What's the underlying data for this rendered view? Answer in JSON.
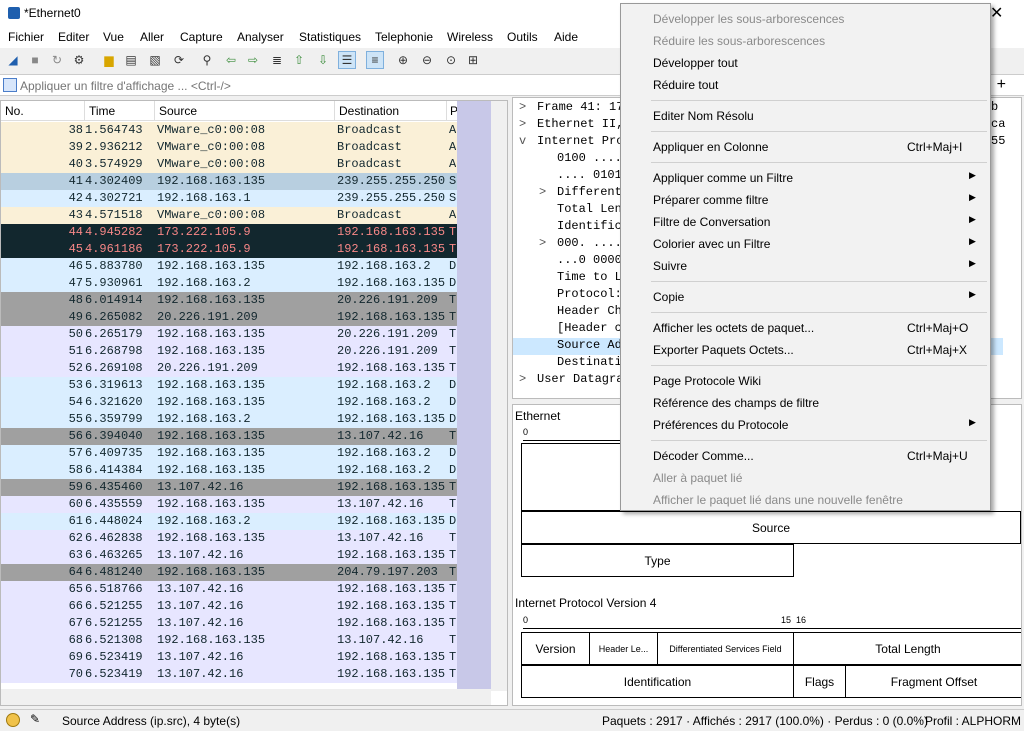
{
  "window": {
    "title": "*Ethernet0",
    "close": "✕"
  },
  "menu": [
    "Fichier",
    "Editer",
    "Vue",
    "Aller",
    "Capture",
    "Analyser",
    "Statistiques",
    "Telephonie",
    "Wireless",
    "Outils",
    "Aide"
  ],
  "filter": {
    "placeholder": "Appliquer un filtre d'affichage ... <Ctrl-/>",
    "add": "+"
  },
  "packet_list": {
    "columns": [
      "No.",
      "Time",
      "Source",
      "Destination",
      "P"
    ],
    "rows": [
      {
        "no": "38",
        "time": "1.564743",
        "src": "VMware_c0:00:08",
        "dst": "Broadcast",
        "proto": "A",
        "bg": "#faf0d7",
        "fg": "#12272e"
      },
      {
        "no": "39",
        "time": "2.936212",
        "src": "VMware_c0:00:08",
        "dst": "Broadcast",
        "proto": "A",
        "bg": "#faf0d7",
        "fg": "#12272e"
      },
      {
        "no": "40",
        "time": "3.574929",
        "src": "VMware_c0:00:08",
        "dst": "Broadcast",
        "proto": "A",
        "bg": "#faf0d7",
        "fg": "#12272e"
      },
      {
        "no": "41",
        "time": "4.302409",
        "src": "192.168.163.135",
        "dst": "239.255.255.250",
        "proto": "S",
        "bg": "#b8cfe0",
        "fg": "#12272e"
      },
      {
        "no": "42",
        "time": "4.302721",
        "src": "192.168.163.1",
        "dst": "239.255.255.250",
        "proto": "S",
        "bg": "#daeeff",
        "fg": "#12272e"
      },
      {
        "no": "43",
        "time": "4.571518",
        "src": "VMware_c0:00:08",
        "dst": "Broadcast",
        "proto": "A",
        "bg": "#faf0d7",
        "fg": "#12272e"
      },
      {
        "no": "44",
        "time": "4.945282",
        "src": "173.222.105.9",
        "dst": "192.168.163.135",
        "proto": "T",
        "bg": "#12272e",
        "fg": "#f78787"
      },
      {
        "no": "45",
        "time": "4.961186",
        "src": "173.222.105.9",
        "dst": "192.168.163.135",
        "proto": "T",
        "bg": "#12272e",
        "fg": "#f78787"
      },
      {
        "no": "46",
        "time": "5.883780",
        "src": "192.168.163.135",
        "dst": "192.168.163.2",
        "proto": "D",
        "bg": "#daeeff",
        "fg": "#12272e"
      },
      {
        "no": "47",
        "time": "5.930961",
        "src": "192.168.163.2",
        "dst": "192.168.163.135",
        "proto": "D",
        "bg": "#daeeff",
        "fg": "#12272e"
      },
      {
        "no": "48",
        "time": "6.014914",
        "src": "192.168.163.135",
        "dst": "20.226.191.209",
        "proto": "T",
        "bg": "#a0a0a0",
        "fg": "#12272e"
      },
      {
        "no": "49",
        "time": "6.265082",
        "src": "20.226.191.209",
        "dst": "192.168.163.135",
        "proto": "T",
        "bg": "#a0a0a0",
        "fg": "#12272e"
      },
      {
        "no": "50",
        "time": "6.265179",
        "src": "192.168.163.135",
        "dst": "20.226.191.209",
        "proto": "T",
        "bg": "#e7e6ff",
        "fg": "#12272e"
      },
      {
        "no": "51",
        "time": "6.268798",
        "src": "192.168.163.135",
        "dst": "20.226.191.209",
        "proto": "T",
        "bg": "#e7e6ff",
        "fg": "#12272e"
      },
      {
        "no": "52",
        "time": "6.269108",
        "src": "20.226.191.209",
        "dst": "192.168.163.135",
        "proto": "T",
        "bg": "#e7e6ff",
        "fg": "#12272e"
      },
      {
        "no": "53",
        "time": "6.319613",
        "src": "192.168.163.135",
        "dst": "192.168.163.2",
        "proto": "D",
        "bg": "#daeeff",
        "fg": "#12272e"
      },
      {
        "no": "54",
        "time": "6.321620",
        "src": "192.168.163.135",
        "dst": "192.168.163.2",
        "proto": "D",
        "bg": "#daeeff",
        "fg": "#12272e"
      },
      {
        "no": "55",
        "time": "6.359799",
        "src": "192.168.163.2",
        "dst": "192.168.163.135",
        "proto": "D",
        "bg": "#daeeff",
        "fg": "#12272e"
      },
      {
        "no": "56",
        "time": "6.394040",
        "src": "192.168.163.135",
        "dst": "13.107.42.16",
        "proto": "T",
        "bg": "#a0a0a0",
        "fg": "#12272e"
      },
      {
        "no": "57",
        "time": "6.409735",
        "src": "192.168.163.135",
        "dst": "192.168.163.2",
        "proto": "D",
        "bg": "#daeeff",
        "fg": "#12272e"
      },
      {
        "no": "58",
        "time": "6.414384",
        "src": "192.168.163.135",
        "dst": "192.168.163.2",
        "proto": "D",
        "bg": "#daeeff",
        "fg": "#12272e"
      },
      {
        "no": "59",
        "time": "6.435460",
        "src": "13.107.42.16",
        "dst": "192.168.163.135",
        "proto": "T",
        "bg": "#a0a0a0",
        "fg": "#12272e"
      },
      {
        "no": "60",
        "time": "6.435559",
        "src": "192.168.163.135",
        "dst": "13.107.42.16",
        "proto": "T",
        "bg": "#e7e6ff",
        "fg": "#12272e"
      },
      {
        "no": "61",
        "time": "6.448024",
        "src": "192.168.163.2",
        "dst": "192.168.163.135",
        "proto": "D",
        "bg": "#daeeff",
        "fg": "#12272e"
      },
      {
        "no": "62",
        "time": "6.462838",
        "src": "192.168.163.135",
        "dst": "13.107.42.16",
        "proto": "T",
        "bg": "#e7e6ff",
        "fg": "#12272e"
      },
      {
        "no": "63",
        "time": "6.463265",
        "src": "13.107.42.16",
        "dst": "192.168.163.135",
        "proto": "T",
        "bg": "#e7e6ff",
        "fg": "#12272e"
      },
      {
        "no": "64",
        "time": "6.481240",
        "src": "192.168.163.135",
        "dst": "204.79.197.203",
        "proto": "T",
        "bg": "#a0a0a0",
        "fg": "#12272e"
      },
      {
        "no": "65",
        "time": "6.518766",
        "src": "13.107.42.16",
        "dst": "192.168.163.135",
        "proto": "T",
        "bg": "#e7e6ff",
        "fg": "#12272e"
      },
      {
        "no": "66",
        "time": "6.521255",
        "src": "13.107.42.16",
        "dst": "192.168.163.135",
        "proto": "T",
        "bg": "#e7e6ff",
        "fg": "#12272e"
      },
      {
        "no": "67",
        "time": "6.521255",
        "src": "13.107.42.16",
        "dst": "192.168.163.135",
        "proto": "T",
        "bg": "#e7e6ff",
        "fg": "#12272e"
      },
      {
        "no": "68",
        "time": "6.521308",
        "src": "192.168.163.135",
        "dst": "13.107.42.16",
        "proto": "T",
        "bg": "#e7e6ff",
        "fg": "#12272e"
      },
      {
        "no": "69",
        "time": "6.523419",
        "src": "13.107.42.16",
        "dst": "192.168.163.135",
        "proto": "T",
        "bg": "#e7e6ff",
        "fg": "#12272e"
      },
      {
        "no": "70",
        "time": "6.523419",
        "src": "13.107.42.16",
        "dst": "192.168.163.135",
        "proto": "T",
        "bg": "#e7e6ff",
        "fg": "#12272e"
      }
    ]
  },
  "details": {
    "lines": [
      {
        "arrow": ">",
        "text": "Frame 41: 17",
        "indent": 0
      },
      {
        "arrow": ">",
        "text": "Ethernet II,",
        "indent": 0
      },
      {
        "arrow": "v",
        "text": "Internet Pro",
        "indent": 0
      },
      {
        "arrow": "",
        "text": "0100 ....",
        "indent": 1
      },
      {
        "arrow": "",
        "text": ".... 0101",
        "indent": 1
      },
      {
        "arrow": ">",
        "text": "Different",
        "indent": 1
      },
      {
        "arrow": "",
        "text": "Total Len",
        "indent": 1
      },
      {
        "arrow": "",
        "text": "Identific",
        "indent": 1
      },
      {
        "arrow": ">",
        "text": "000. ....",
        "indent": 1
      },
      {
        "arrow": "",
        "text": "...0 0000",
        "indent": 1
      },
      {
        "arrow": "",
        "text": "Time to L",
        "indent": 1
      },
      {
        "arrow": "",
        "text": "Protocol:",
        "indent": 1
      },
      {
        "arrow": "",
        "text": "Header Ch",
        "indent": 1
      },
      {
        "arrow": "",
        "text": "[Header c",
        "indent": 1
      },
      {
        "arrow": "",
        "text": "Source Ad",
        "indent": 1,
        "selected": true
      },
      {
        "arrow": "",
        "text": "Destinati",
        "indent": 1
      },
      {
        "arrow": ">",
        "text": "User Datagra",
        "indent": 0
      }
    ],
    "right_fragments": [
      "b",
      "ca",
      "55"
    ]
  },
  "bytes_pane": {
    "ethernet_label": "Ethernet",
    "ip_label": "Internet Protocol Version 4",
    "ruler_start": "0",
    "ruler_15": "15",
    "ruler_16": "16",
    "source": "Source",
    "type": "Type",
    "version": "Version",
    "header_len": "Header Le...",
    "dsf": "Differentiated Services Field",
    "total_length": "Total Length",
    "identification": "Identification",
    "flags": "Flags",
    "fragment_offset": "Fragment Offset"
  },
  "context_menu": {
    "items": [
      {
        "label": "Développer les sous-arborescences",
        "shortcut": "",
        "disabled": true,
        "arrow": false,
        "sep_before": false
      },
      {
        "label": "Réduire les sous-arborescences",
        "shortcut": "",
        "disabled": true,
        "arrow": false,
        "sep_before": false
      },
      {
        "label": "Développer tout",
        "shortcut": "",
        "disabled": false,
        "arrow": false,
        "sep_before": false
      },
      {
        "label": "Réduire tout",
        "shortcut": "",
        "disabled": false,
        "arrow": false,
        "sep_before": false
      },
      {
        "label": "Editer Nom Résolu",
        "shortcut": "",
        "disabled": false,
        "arrow": false,
        "sep_before": true
      },
      {
        "label": "Appliquer en Colonne",
        "shortcut": "Ctrl+Maj+I",
        "disabled": false,
        "arrow": false,
        "sep_before": true
      },
      {
        "label": "Appliquer comme un Filtre",
        "shortcut": "",
        "disabled": false,
        "arrow": true,
        "sep_before": true
      },
      {
        "label": "Préparer comme filtre",
        "shortcut": "",
        "disabled": false,
        "arrow": true,
        "sep_before": false
      },
      {
        "label": "Filtre de Conversation",
        "shortcut": "",
        "disabled": false,
        "arrow": true,
        "sep_before": false
      },
      {
        "label": "Colorier avec un Filtre",
        "shortcut": "",
        "disabled": false,
        "arrow": true,
        "sep_before": false
      },
      {
        "label": "Suivre",
        "shortcut": "",
        "disabled": false,
        "arrow": true,
        "sep_before": false
      },
      {
        "label": "Copie",
        "shortcut": "",
        "disabled": false,
        "arrow": true,
        "sep_before": true
      },
      {
        "label": "Afficher les octets de paquet...",
        "shortcut": "Ctrl+Maj+O",
        "disabled": false,
        "arrow": false,
        "sep_before": true
      },
      {
        "label": "Exporter Paquets Octets...",
        "shortcut": "Ctrl+Maj+X",
        "disabled": false,
        "arrow": false,
        "sep_before": false
      },
      {
        "label": "Page Protocole Wiki",
        "shortcut": "",
        "disabled": false,
        "arrow": false,
        "sep_before": true
      },
      {
        "label": "Référence des champs de filtre",
        "shortcut": "",
        "disabled": false,
        "arrow": false,
        "sep_before": false
      },
      {
        "label": "Préférences du Protocole",
        "shortcut": "",
        "disabled": false,
        "arrow": true,
        "sep_before": false
      },
      {
        "label": "Décoder Comme...",
        "shortcut": "Ctrl+Maj+U",
        "disabled": false,
        "arrow": false,
        "sep_before": true
      },
      {
        "label": "Aller à paquet lié",
        "shortcut": "",
        "disabled": true,
        "arrow": false,
        "sep_before": false
      },
      {
        "label": "Afficher le paquet lié dans une nouvelle fenêtre",
        "shortcut": "",
        "disabled": true,
        "arrow": false,
        "sep_before": false
      }
    ]
  },
  "status": {
    "field": "Source Address (ip.src), 4 byte(s)",
    "packets": "Paquets : 2917 · Affichés : 2917 (100.0%) · Perdus : 0 (0.0%)",
    "profile": "Profil : ALPHORM"
  }
}
